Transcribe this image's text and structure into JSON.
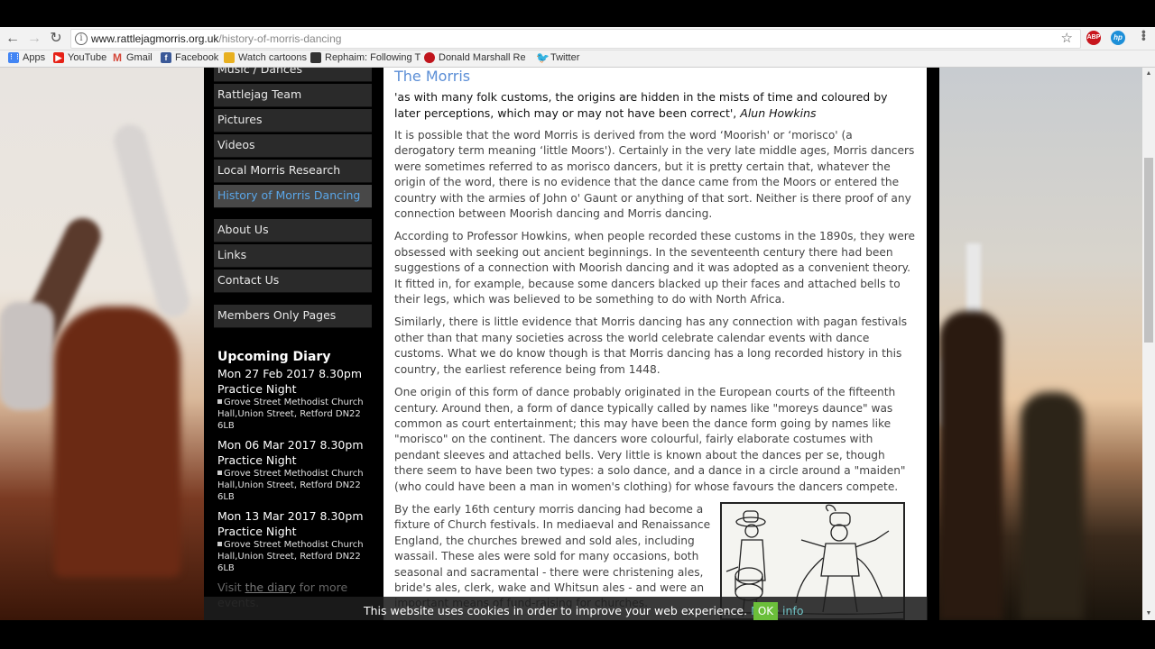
{
  "browser": {
    "url_host": "www.rattlejagmorris.org.uk",
    "url_path": "/history-of-morris-dancing",
    "extensions": [
      "ABP",
      "hp"
    ],
    "bookmarks": [
      {
        "label": "Apps",
        "icon": "apps-grid-icon",
        "color": "#4285f4"
      },
      {
        "label": "YouTube",
        "icon": "youtube-icon",
        "color": "#e62117"
      },
      {
        "label": "Gmail",
        "icon": "gmail-icon",
        "color": "#d44638"
      },
      {
        "label": "Facebook",
        "icon": "facebook-icon",
        "color": "#3b5998"
      },
      {
        "label": "Watch cartoons",
        "icon": "cartoon-icon",
        "color": "#e8b020"
      },
      {
        "label": "Rephaim: Following T",
        "icon": "rephaim-icon",
        "color": "#333333"
      },
      {
        "label": "Donald Marshall Revo",
        "icon": "red-dot-icon",
        "color": "#c0141c"
      },
      {
        "label": "Twitter",
        "icon": "twitter-icon",
        "color": "#1da1f2"
      }
    ]
  },
  "sidebar": {
    "nav_groups": [
      [
        "Music / Dances",
        "Rattlejag Team",
        "Pictures",
        "Videos",
        "Local Morris Research",
        "History of Morris Dancing"
      ],
      [
        "About Us",
        "Links",
        "Contact Us"
      ],
      [
        "Members Only Pages"
      ]
    ],
    "active_item": "History of Morris Dancing",
    "diary": {
      "heading": "Upcoming Diary",
      "events": [
        {
          "date": "Mon 27 Feb 2017 8.30pm",
          "title": "Practice Night",
          "location": "Grove Street Methodist Church Hall,Union Street, Retford DN22 6LB"
        },
        {
          "date": "Mon 06 Mar 2017 8.30pm",
          "title": "Practice Night",
          "location": "Grove Street Methodist Church Hall,Union Street, Retford DN22 6LB"
        },
        {
          "date": "Mon 13 Mar 2017 8.30pm",
          "title": "Practice Night",
          "location": "Grove Street Methodist Church Hall,Union Street, Retford DN22 6LB"
        }
      ],
      "more_prefix": "Visit ",
      "more_link": "the diary",
      "more_suffix": " for more events."
    }
  },
  "content": {
    "heading": "The Morris",
    "quote": "'as with many folk customs, the origins are hidden in the mists of time and coloured by later perceptions, which may or may not have been correct',",
    "quote_author": "Alun Howkins",
    "paragraphs": [
      "It is possible that the word Morris is derived from the word ‘Moorish' or ‘morisco' (a derogatory term meaning ‘little Moors'). Certainly in the very late middle ages, Morris dancers were sometimes referred to as morisco dancers, but it is pretty certain that, whatever the origin of the word, there is no evidence that the dance came from the Moors or entered the country with the armies of John o' Gaunt or anything of that sort. Neither is there proof of any connection between Moorish dancing and Morris dancing.",
      "According to Professor Howkins, when people recorded these customs in the 1890s, they were obsessed with seeking out ancient beginnings. In the seventeenth century there had been suggestions of a connection with Moorish dancing and it was adopted as a convenient theory. It fitted in, for example, because some dancers blacked up their faces and attached bells to their legs, which was believed to be something to do with North Africa.",
      "Similarly, there is little evidence that Morris dancing has any connection with pagan festivals other than that many societies across the world celebrate calendar events with dance customs. What we do know though is that Morris dancing has a long recorded history in this country, the earliest reference being from 1448.",
      "One origin of this form of dance probably originated in the European courts of the fifteenth century.  Around then, a form of dance typically called by names like \"moreys daunce\" was common as court entertainment; this may have been the dance form going by names like \"morisco\" on the continent. The dancers wore colourful, fairly elaborate costumes with pendant sleeves and attached bells. Very little is known about the dances per se, though there seem to have been two types: a solo dance, and a dance in a circle around a \"maiden\" (who could have been a man in women's clothing) for whose favours the dancers compete.",
      "By the early 16th century morris dancing had become a fixture of Church festivals. In mediaeval and Renaissance England, the churches brewed and sold ales, including wassail. These ales were sold for many occasions, both seasonal and sacramental - there were christening ales, bride's ales, clerk, wake and Whitsun ales - and were an important means of fund-raising for churches."
    ],
    "image_alt": "Woodcut of a drummer and a morris dancer"
  },
  "cookie": {
    "text": "This website uses cookies in order to improve your web experience. ",
    "more_info": "More info",
    "ok": "OK"
  }
}
